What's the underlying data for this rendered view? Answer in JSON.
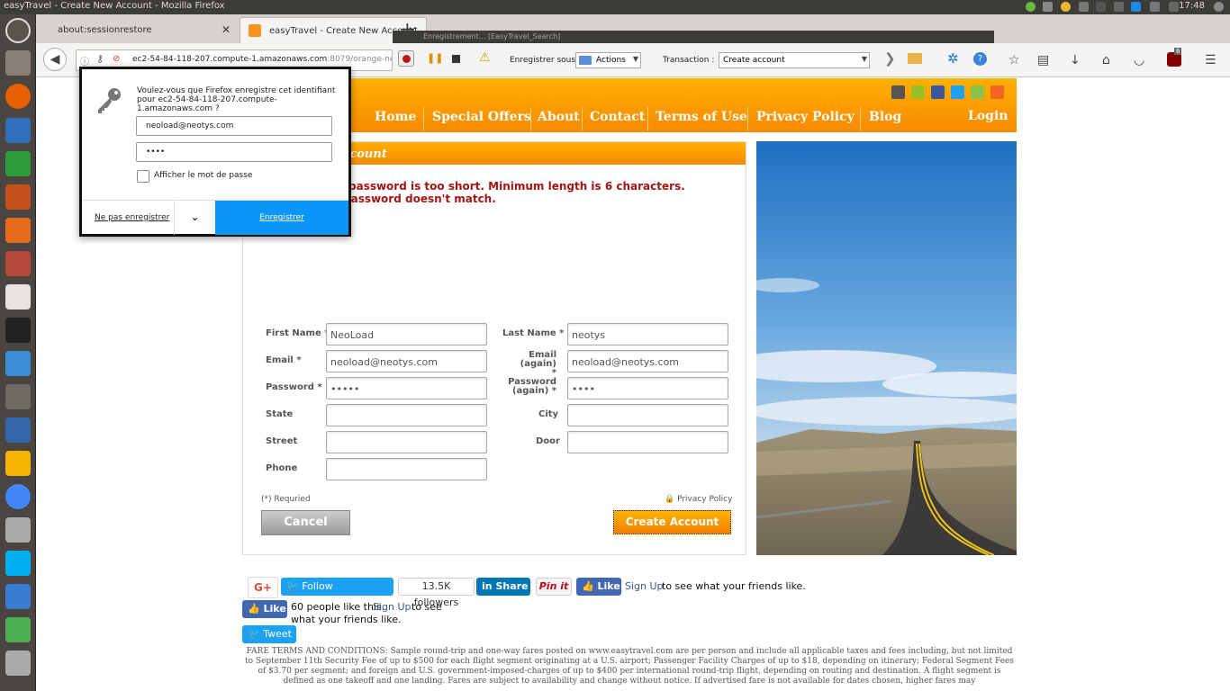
{
  "window": {
    "title": "easyTravel - Create New Account - Mozilla Firefox",
    "clock": "17:48"
  },
  "tabs": [
    {
      "label": "about:sessionrestore",
      "close": "✕"
    },
    {
      "label": "easyTravel - Create New Account",
      "close": "✕"
    }
  ],
  "navbar": {
    "url_host": "ec2-54-84-118-207.compute-1.amazonaws.com",
    "url_path": ":8079/orange-newaccount",
    "ublock_count": "6"
  },
  "neoload": {
    "window_title": "Enregistrement... [EasyTravel_Search]",
    "save_under_label": "Enregistrer sous :",
    "save_under_value": "Actions",
    "transaction_label": "Transaction :",
    "transaction_value": "Create account"
  },
  "site_nav": {
    "items": [
      "Home",
      "Special Offers",
      "About",
      "Contact",
      "Terms of Use",
      "Privacy Policy",
      "Blog"
    ],
    "login": "Login"
  },
  "form": {
    "header": "account",
    "errors": [
      "password is too short. Minimum length is 6 characters.",
      "password doesn't match."
    ],
    "fields": {
      "first_name": {
        "label": "First Name *",
        "value": "NeoLoad"
      },
      "last_name": {
        "label": "Last Name *",
        "value": "neotys"
      },
      "email": {
        "label": "Email *",
        "value": "neoload@neotys.com"
      },
      "email_again": {
        "label": "Email (again) *",
        "value": "neoload@neotys.com"
      },
      "password": {
        "label": "Password *",
        "value": "•••••"
      },
      "password_again": {
        "label": "Password (again) *",
        "value": "••••"
      },
      "state": {
        "label": "State",
        "value": ""
      },
      "city": {
        "label": "City",
        "value": ""
      },
      "street": {
        "label": "Street",
        "value": ""
      },
      "door": {
        "label": "Door",
        "value": ""
      },
      "phone": {
        "label": "Phone",
        "value": ""
      }
    },
    "required_note": "(*) Requried",
    "privacy_link": "Privacy Policy",
    "cancel": "Cancel",
    "create": "Create Account"
  },
  "social": {
    "gplus": "G+",
    "follow": "Follow @dynatrace",
    "followers": "13.5K followers",
    "share": "Share",
    "pinit": "Pin it",
    "like": "Like",
    "signup": "Sign Up",
    "friends": "to see what your friends like.",
    "like_count_text": "60 people like this.",
    "signup2": "Sign Up",
    "friends2a": "to see",
    "friends2b": "what your friends like.",
    "tweet": "Tweet"
  },
  "fare_terms": "FARE TERMS AND CONDITIONS: Sample round-trip and one-way fares posted on www.easytravel.com are per person and include all applicable taxes and fees including, but not limited to September 11th Security Fee of up to $500 for each flight segment originating at a U.S. airport; Passenger Facility Charges of up to $18, depending on itinerary; Federal Segment Fees of $3.70 per segment; and foreign and U.S. government-imposed-charges of up to $400 per international round-trip flight, depending on routing and destination. A flight segment is defined as one takeoff and one landing. Fares are subject to availability and change without notice. If advertised fare is not available for dates chosen, higher fares may",
  "password_dialog": {
    "message": "Voulez-vous que Firefox enregistre cet identifiant pour ec2-54-84-118-207.compute-1.amazonaws.com ?",
    "username": "neoload@neotys.com",
    "password": "••••",
    "show_password": "Afficher le mot de passe",
    "never": "Ne pas enregistrer",
    "save": "Enregistrer"
  },
  "colors": {
    "accent_orange": "#f78a00",
    "error_red": "#a31515",
    "firefox_blue": "#0996f8"
  }
}
